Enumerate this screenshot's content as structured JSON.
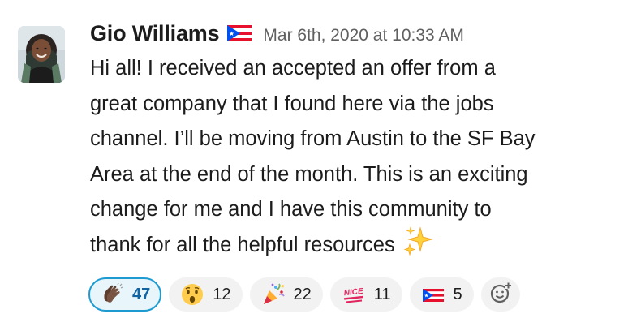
{
  "message": {
    "author": "Gio Williams",
    "author_status_icon": "puerto-rico-flag",
    "timestamp": "Mar 6th, 2020 at 10:33 AM",
    "body_lines": [
      "Hi all! I received an accepted an offer from a",
      "great company that I found here via the jobs",
      "channel. I’ll be moving from Austin to the SF Bay",
      "Area at the end of the month. This is an exciting",
      "change for me and I have this community to",
      "thank for all the helpful resources"
    ],
    "trailing_emoji": "sparkles"
  },
  "reactions": [
    {
      "emoji": "clap",
      "count": "47",
      "active": true
    },
    {
      "emoji": "hushed-face",
      "count": "12",
      "active": false
    },
    {
      "emoji": "party-popper",
      "count": "22",
      "active": false
    },
    {
      "emoji": "nice",
      "count": "11",
      "active": false
    },
    {
      "emoji": "puerto-rico-flag",
      "count": "5",
      "active": false
    }
  ],
  "add_reaction_icon": "add-emoji-icon",
  "colors": {
    "text": "#1d1c1d",
    "muted": "#616061",
    "active_border": "#1d9bd1",
    "active_bg": "#e8f5fa",
    "pill_bg": "#f2f2f2"
  }
}
